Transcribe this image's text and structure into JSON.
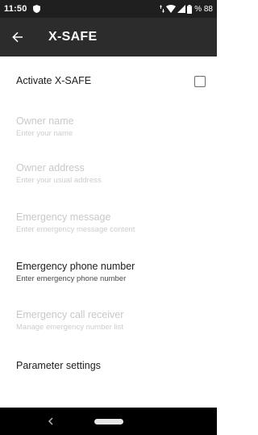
{
  "status_bar": {
    "time": "11:50",
    "battery_text": "% 88",
    "icons": [
      "shield-icon",
      "data-arrows-icon",
      "wifi-icon",
      "signal-icon",
      "battery-icon"
    ]
  },
  "app_bar": {
    "title": "X-SAFE",
    "back_icon": "back-arrow-icon"
  },
  "settings": {
    "activate": {
      "label": "Activate X-SAFE",
      "checked": false
    },
    "owner_name": {
      "title": "Owner name",
      "subtitle": "Enter your name",
      "enabled": false
    },
    "owner_address": {
      "title": "Owner address",
      "subtitle": "Enter your usual address",
      "enabled": false
    },
    "emergency_message": {
      "title": "Emergency message",
      "subtitle": "Enter emergency message content",
      "enabled": false
    },
    "emergency_phone": {
      "title": "Emergency phone number",
      "subtitle": "Enter emergency phone number",
      "enabled": true
    },
    "emergency_receiver": {
      "title": "Emergency call receiver",
      "subtitle": "Manage emergency number list",
      "enabled": false
    },
    "parameter_settings": {
      "title": "Parameter settings",
      "enabled": true
    }
  },
  "nav_bar": {
    "icons": [
      "nav-back-icon",
      "home-pill-icon"
    ]
  },
  "colors": {
    "status_bar_bg": "#1f1f1f",
    "app_bar_bg": "#2c2c2c",
    "enabled_text": "#202020",
    "disabled_text": "#c8c8c8",
    "nav_bar_bg": "#000000"
  }
}
